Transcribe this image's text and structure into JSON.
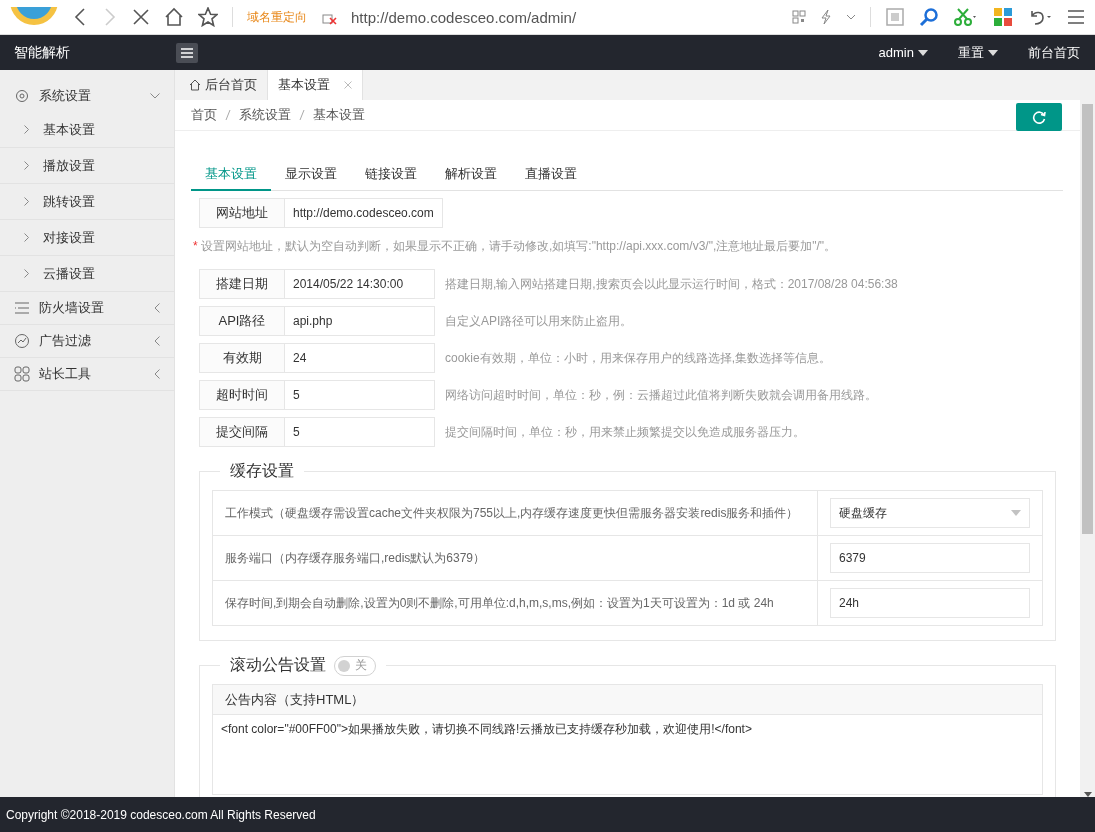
{
  "browser": {
    "redirect_label": "域名重定向",
    "url": "http://demo.codesceo.com/admin/"
  },
  "header": {
    "title": "智能解析",
    "nav": [
      {
        "label": "admin",
        "has_menu": true
      },
      {
        "label": "重置",
        "has_menu": true
      },
      {
        "label": "前台首页",
        "has_menu": false
      }
    ]
  },
  "sidebar": {
    "items": [
      {
        "label": "系统设置",
        "expanded": true,
        "children": [
          {
            "label": "基本设置"
          },
          {
            "label": "播放设置"
          },
          {
            "label": "跳转设置"
          },
          {
            "label": "对接设置"
          },
          {
            "label": "云播设置"
          }
        ]
      },
      {
        "label": "防火墙设置",
        "expanded": false
      },
      {
        "label": "广告过滤",
        "expanded": false
      },
      {
        "label": "站长工具",
        "expanded": false
      }
    ]
  },
  "page_tabs": [
    {
      "label": "后台首页",
      "selected": false,
      "closable": false
    },
    {
      "label": "基本设置",
      "selected": true,
      "closable": true
    }
  ],
  "breadcrumb": [
    "首页",
    "系统设置",
    "基本设置"
  ],
  "form_tabs": [
    {
      "label": "基本设置",
      "selected": true
    },
    {
      "label": "显示设置",
      "selected": false
    },
    {
      "label": "链接设置",
      "selected": false
    },
    {
      "label": "解析设置",
      "selected": false
    },
    {
      "label": "直播设置",
      "selected": false
    }
  ],
  "fields": [
    {
      "label": "网站地址",
      "value": "http://demo.codesceo.com",
      "kind": "hint_below",
      "hint_mark": "*",
      "hint": "设置网站地址，默认为空自动判断，如果显示不正确，请手动修改,如填写:\"http://api.xxx.com/v3/\",注意地址最后要加\"/\"。"
    },
    {
      "label": "搭建日期",
      "value": "2014/05/22 14:30:00",
      "kind": "hint_inline",
      "hint": "搭建日期,输入网站搭建日期,搜索页会以此显示运行时间，格式：2017/08/28 04:56:38"
    },
    {
      "label": "API路径",
      "value": "api.php",
      "kind": "hint_inline",
      "hint": "自定义API路径可以用来防止盗用。"
    },
    {
      "label": "有效期",
      "value": "24",
      "kind": "hint_inline",
      "hint": "cookie有效期，单位：小时，用来保存用户的线路选择,集数选择等信息。"
    },
    {
      "label": "超时时间",
      "value": "5",
      "kind": "hint_inline",
      "hint": "网络访问超时时间，单位：秒，例：云播超过此值将判断失败就会调用备用线路。"
    },
    {
      "label": "提交间隔",
      "value": "5",
      "kind": "hint_inline",
      "hint": "提交间隔时间，单位：秒，用来禁止频繁提交以免造成服务器压力。"
    }
  ],
  "cache": {
    "title": "缓存设置",
    "rows": [
      {
        "label": "工作模式（硬盘缓存需设置cache文件夹权限为755以上,内存缓存速度更快但需服务器安装redis服务和插件）",
        "kind": "select",
        "value": "硬盘缓存"
      },
      {
        "label": "服务端口（内存缓存服务端口,redis默认为6379）",
        "kind": "input",
        "value": "6379"
      },
      {
        "label": "保存时间,到期会自动删除,设置为0则不删除,可用单位:d,h,m,s,ms,例如：设置为1天可设置为：1d 或 24h",
        "kind": "input",
        "value": "24h"
      }
    ]
  },
  "notice": {
    "title": "滚动公告设置",
    "switch": {
      "label": "关",
      "on": false
    },
    "column_header": "公告内容（支持HTML）",
    "content": "<font color=\"#00FF00\">如果播放失败，请切换不同线路!云播放已支持缓存秒加载，欢迎使用!</font>"
  },
  "footer": "Copyright ©2018-2019 codesceo.com All Rights Reserved"
}
